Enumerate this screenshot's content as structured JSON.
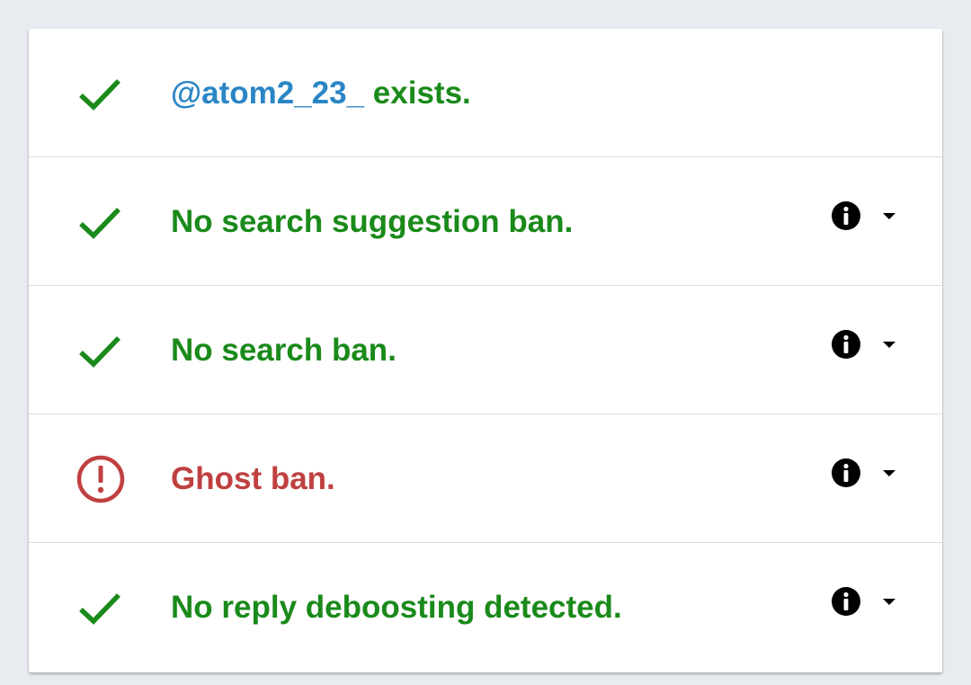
{
  "colors": {
    "ok": "#1a8a1a",
    "bad": "#c04040",
    "handle": "#2b86c5"
  },
  "rows": [
    {
      "status": "ok",
      "icon": "check-icon",
      "handle": "@atom2_23_",
      "text": " exists.",
      "has_details": false
    },
    {
      "status": "ok",
      "icon": "check-icon",
      "text": "No search suggestion ban.",
      "has_details": true
    },
    {
      "status": "ok",
      "icon": "check-icon",
      "text": "No search ban.",
      "has_details": true
    },
    {
      "status": "bad",
      "icon": "alert-circle-icon",
      "text": "Ghost ban.",
      "has_details": true
    },
    {
      "status": "ok",
      "icon": "check-icon",
      "text": "No reply deboosting detected.",
      "has_details": true
    }
  ]
}
